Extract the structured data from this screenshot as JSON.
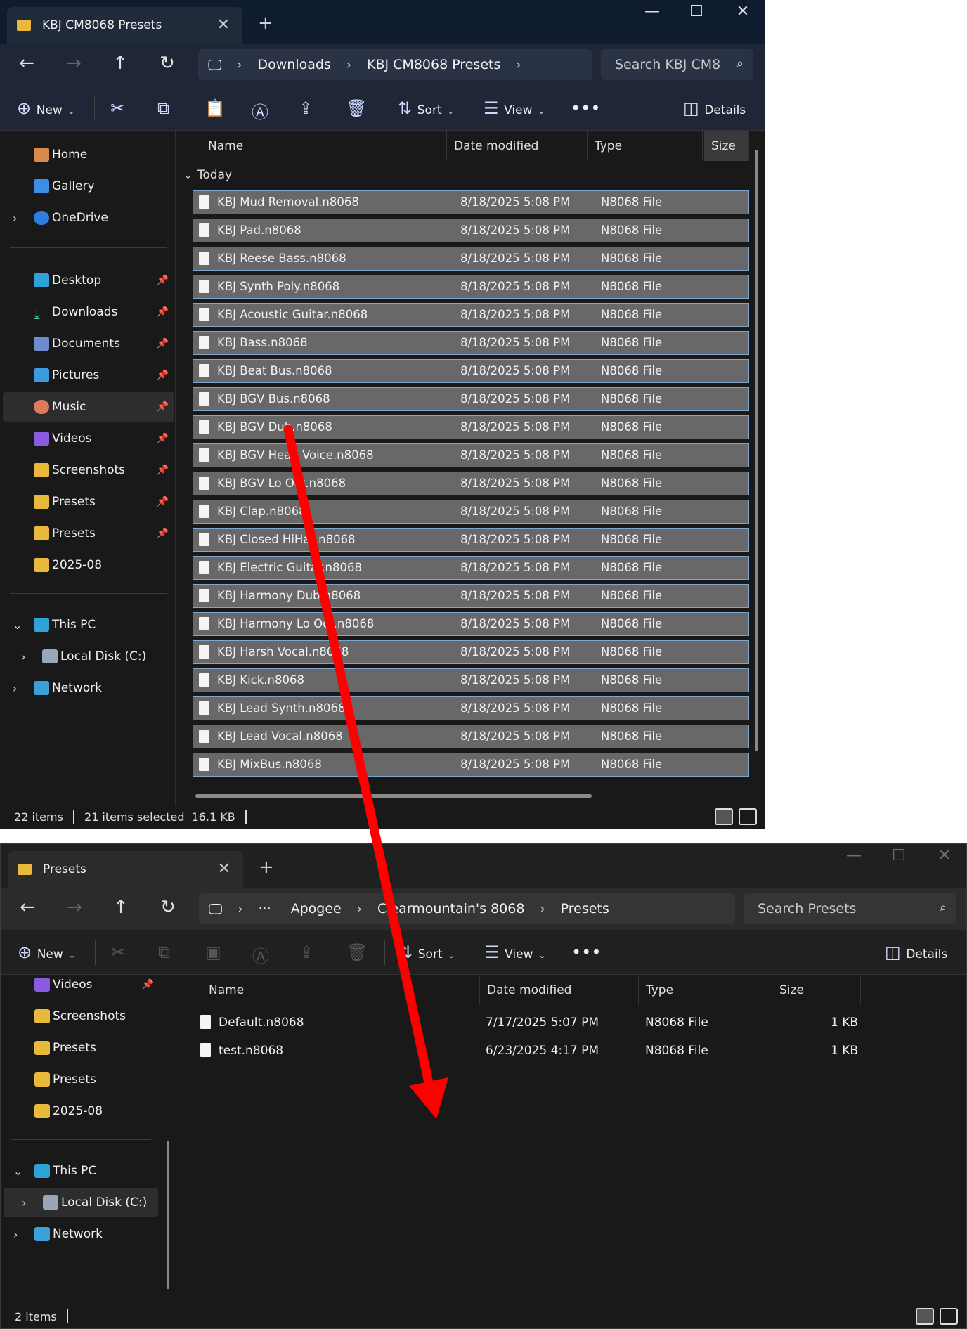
{
  "window1": {
    "tab_title": "KBJ CM8068 Presets",
    "breadcrumb": [
      "Downloads",
      "KBJ CM8068 Presets"
    ],
    "search_placeholder": "Search KBJ CM8",
    "toolbar": {
      "new": "New",
      "sort": "Sort",
      "view": "View",
      "details": "Details"
    },
    "columns": {
      "name": "Name",
      "date": "Date modified",
      "type": "Type",
      "size": "Size"
    },
    "group": "Today",
    "sidebar": {
      "home": "Home",
      "gallery": "Gallery",
      "onedrive": "OneDrive",
      "desktop": "Desktop",
      "downloads": "Downloads",
      "documents": "Documents",
      "pictures": "Pictures",
      "music": "Music",
      "videos": "Videos",
      "screenshots": "Screenshots",
      "presets1": "Presets",
      "presets2": "Presets",
      "folder2025": "2025-08",
      "thispc": "This PC",
      "localdisk": "Local Disk (C:)",
      "network": "Network"
    },
    "files": [
      {
        "name": "KBJ Mud Removal.n8068",
        "date": "8/18/2025 5:08 PM",
        "type": "N8068 File"
      },
      {
        "name": "KBJ Pad.n8068",
        "date": "8/18/2025 5:08 PM",
        "type": "N8068 File"
      },
      {
        "name": "KBJ Reese Bass.n8068",
        "date": "8/18/2025 5:08 PM",
        "type": "N8068 File"
      },
      {
        "name": "KBJ Synth Poly.n8068",
        "date": "8/18/2025 5:08 PM",
        "type": "N8068 File"
      },
      {
        "name": "KBJ Acoustic Guitar.n8068",
        "date": "8/18/2025 5:08 PM",
        "type": "N8068 File"
      },
      {
        "name": "KBJ Bass.n8068",
        "date": "8/18/2025 5:08 PM",
        "type": "N8068 File"
      },
      {
        "name": "KBJ Beat Bus.n8068",
        "date": "8/18/2025 5:08 PM",
        "type": "N8068 File"
      },
      {
        "name": "KBJ BGV Bus.n8068",
        "date": "8/18/2025 5:08 PM",
        "type": "N8068 File"
      },
      {
        "name": "KBJ BGV Dub.n8068",
        "date": "8/18/2025 5:08 PM",
        "type": "N8068 File"
      },
      {
        "name": "KBJ BGV Head Voice.n8068",
        "date": "8/18/2025 5:08 PM",
        "type": "N8068 File"
      },
      {
        "name": "KBJ BGV Lo Oct.n8068",
        "date": "8/18/2025 5:08 PM",
        "type": "N8068 File"
      },
      {
        "name": "KBJ Clap.n8068",
        "date": "8/18/2025 5:08 PM",
        "type": "N8068 File"
      },
      {
        "name": "KBJ Closed HiHat.n8068",
        "date": "8/18/2025 5:08 PM",
        "type": "N8068 File"
      },
      {
        "name": "KBJ Electric Guitar.n8068",
        "date": "8/18/2025 5:08 PM",
        "type": "N8068 File"
      },
      {
        "name": "KBJ Harmony Dub.n8068",
        "date": "8/18/2025 5:08 PM",
        "type": "N8068 File"
      },
      {
        "name": "KBJ Harmony Lo Oct.n8068",
        "date": "8/18/2025 5:08 PM",
        "type": "N8068 File"
      },
      {
        "name": "KBJ Harsh Vocal.n8068",
        "date": "8/18/2025 5:08 PM",
        "type": "N8068 File"
      },
      {
        "name": "KBJ Kick.n8068",
        "date": "8/18/2025 5:08 PM",
        "type": "N8068 File"
      },
      {
        "name": "KBJ Lead Synth.n8068",
        "date": "8/18/2025 5:08 PM",
        "type": "N8068 File"
      },
      {
        "name": "KBJ Lead Vocal.n8068",
        "date": "8/18/2025 5:08 PM",
        "type": "N8068 File"
      },
      {
        "name": "KBJ MixBus.n8068",
        "date": "8/18/2025 5:08 PM",
        "type": "N8068 File"
      }
    ],
    "status": {
      "count": "22 items",
      "selected": "21 items selected",
      "size": "16.1 KB"
    }
  },
  "window2": {
    "tab_title": "Presets",
    "breadcrumb": [
      "Apogee",
      "Clearmountain's 8068",
      "Presets"
    ],
    "ellipsis": "···",
    "search_placeholder": "Search Presets",
    "toolbar": {
      "new": "New",
      "sort": "Sort",
      "view": "View",
      "details": "Details"
    },
    "columns": {
      "name": "Name",
      "date": "Date modified",
      "type": "Type",
      "size": "Size"
    },
    "sidebar": {
      "videos": "Videos",
      "screenshots": "Screenshots",
      "presets1": "Presets",
      "presets2": "Presets",
      "folder2025": "2025-08",
      "thispc": "This PC",
      "localdisk": "Local Disk (C:)",
      "network": "Network"
    },
    "files": [
      {
        "name": "Default.n8068",
        "date": "7/17/2025 5:07 PM",
        "type": "N8068 File",
        "size": "1 KB"
      },
      {
        "name": "test.n8068",
        "date": "6/23/2025 4:17 PM",
        "type": "N8068 File",
        "size": "1 KB"
      }
    ],
    "status": {
      "count": "2 items"
    }
  },
  "colors": {
    "arrow": "#ff0000",
    "folder": "#e8b93a",
    "selection": "#686868"
  }
}
